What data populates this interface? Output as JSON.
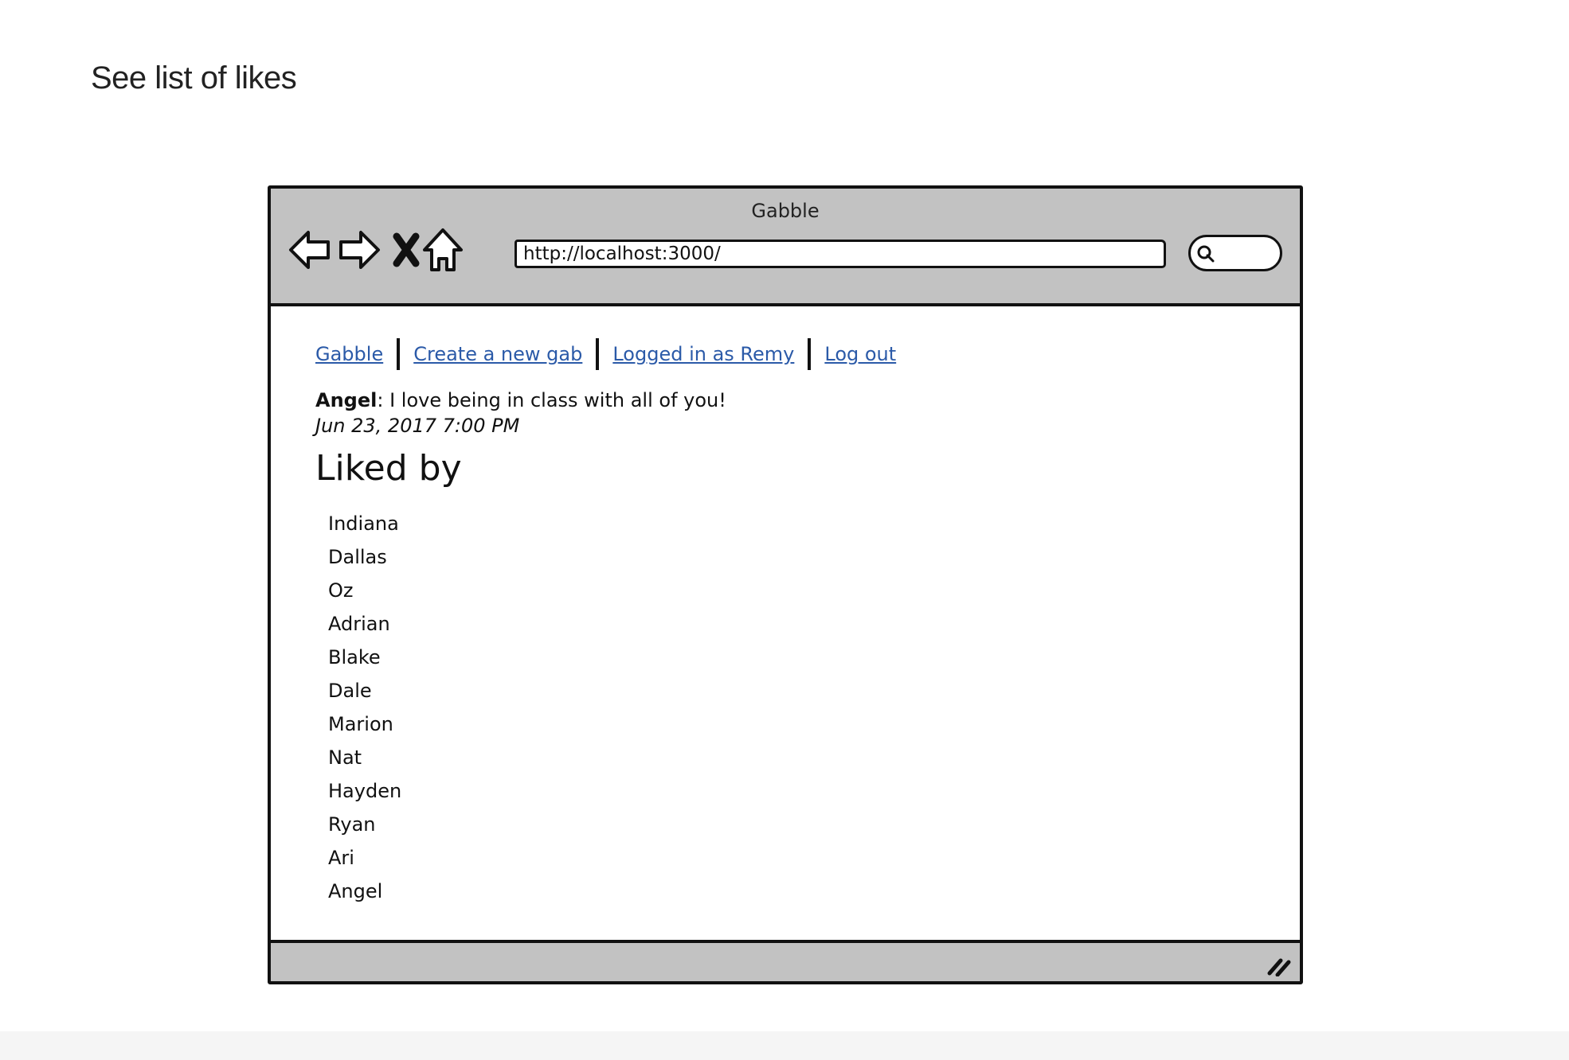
{
  "page": {
    "heading": "See list of likes"
  },
  "browser": {
    "window_title": "Gabble",
    "url": "http://localhost:3000/",
    "search": {
      "value": ""
    },
    "icons": [
      "back-arrow-icon",
      "forward-arrow-icon",
      "stop-icon",
      "home-icon",
      "search-icon",
      "resize-grip-icon"
    ]
  },
  "site": {
    "nav": [
      "Gabble",
      "Create a new gab",
      "Logged in as Remy",
      "Log out"
    ],
    "gab": {
      "author": "Angel",
      "separator": ":",
      "text": " I love being in class with all of you!",
      "date": "Jun 23, 2017 7:00 PM"
    },
    "liked_by_heading": "Liked by",
    "likers": [
      "Indiana",
      "Dallas",
      "Oz",
      "Adrian",
      "Blake",
      "Dale",
      "Marion",
      "Nat",
      "Hayden",
      "Ryan",
      "Ari",
      "Angel"
    ]
  },
  "colors": {
    "chrome": "#c2c2c2",
    "link": "#2b5aa8",
    "border": "#111111"
  }
}
